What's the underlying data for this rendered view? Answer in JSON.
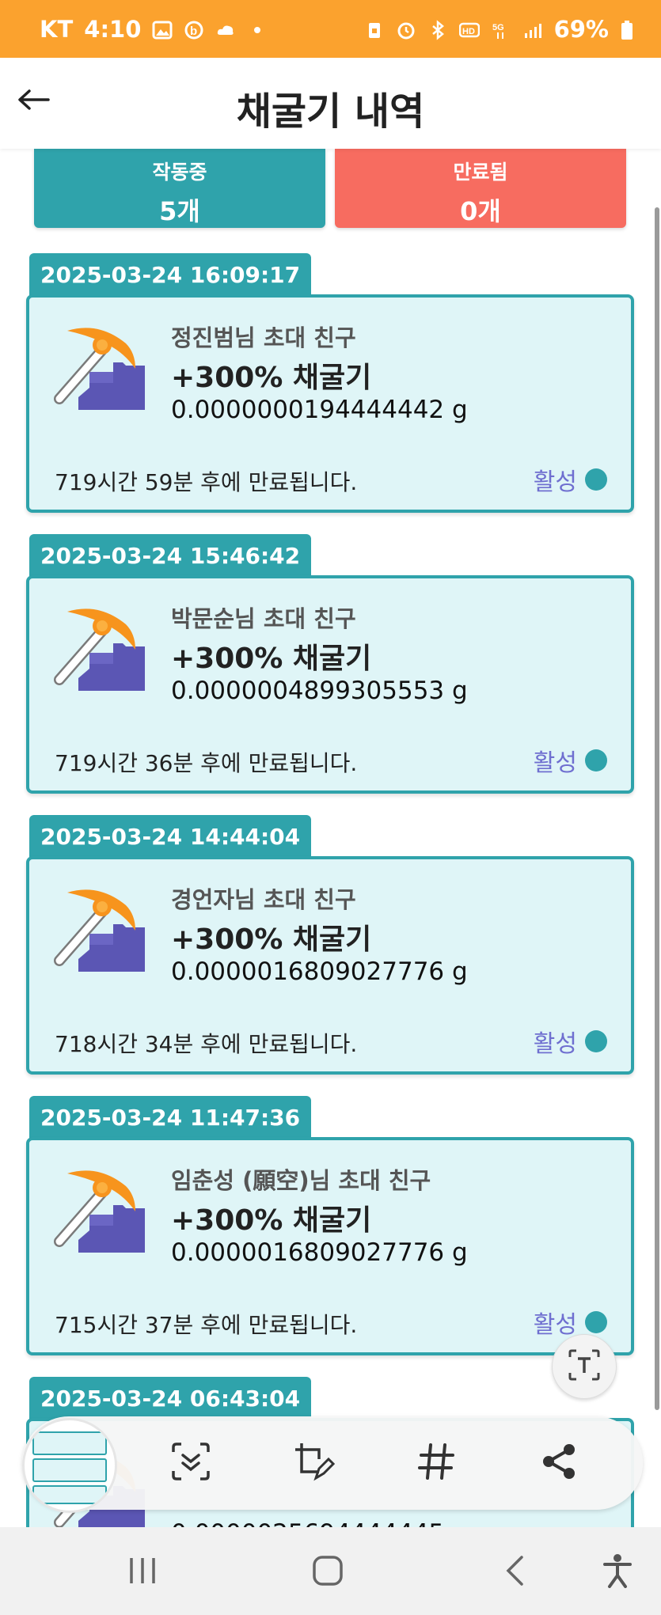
{
  "status_bar": {
    "carrier": "KT",
    "time": "4:10",
    "battery": "69%"
  },
  "header": {
    "title": "채굴기 내역"
  },
  "summary": {
    "active_label": "작동중",
    "active_count": "5개",
    "expired_label": "만료됨",
    "expired_count": "0개"
  },
  "miners": [
    {
      "date": "2025-03-24 16:09:17",
      "inviter": "정진범님 초대 친구",
      "name": "+300% 채굴기",
      "amount": "0.0000000194444442 g",
      "expire": "719시간 59분 후에 만료됩니다.",
      "status": "활성"
    },
    {
      "date": "2025-03-24 15:46:42",
      "inviter": "박문순님 초대 친구",
      "name": "+300% 채굴기",
      "amount": "0.0000004899305553 g",
      "expire": "719시간 36분 후에 만료됩니다.",
      "status": "활성"
    },
    {
      "date": "2025-03-24 14:44:04",
      "inviter": "경언자님 초대 친구",
      "name": "+300% 채굴기",
      "amount": "0.0000016809027776 g",
      "expire": "718시간 34분 후에 만료됩니다.",
      "status": "활성"
    },
    {
      "date": "2025-03-24 11:47:36",
      "inviter": "임춘성 (願空)님 초대 친구",
      "name": "+300% 채굴기",
      "amount": "0.0000016809027776 g",
      "expire": "715시간 37분 후에 만료됩니다.",
      "status": "활성"
    },
    {
      "date": "2025-03-24 06:43:04",
      "inviter": "",
      "name": "",
      "amount": "0.0000025694444445 g",
      "expire": "",
      "status": ""
    }
  ],
  "colors": {
    "accent": "#2fa3ab",
    "expired": "#f76c60",
    "status_bar": "#fba22e",
    "card_bg": "#dff5f7",
    "active_text": "#6f6fd0"
  },
  "icons": {
    "back": "arrow-left-icon",
    "miner": "pickaxe-icon",
    "ocr": "text-extract-icon",
    "capture_scroll": "scroll-capture-icon",
    "capture_edit": "crop-edit-icon",
    "tag": "hashtag-icon",
    "share": "share-icon",
    "nav_recents": "recents-icon",
    "nav_home": "home-icon",
    "nav_back": "nav-back-icon",
    "accessibility": "accessibility-icon"
  }
}
